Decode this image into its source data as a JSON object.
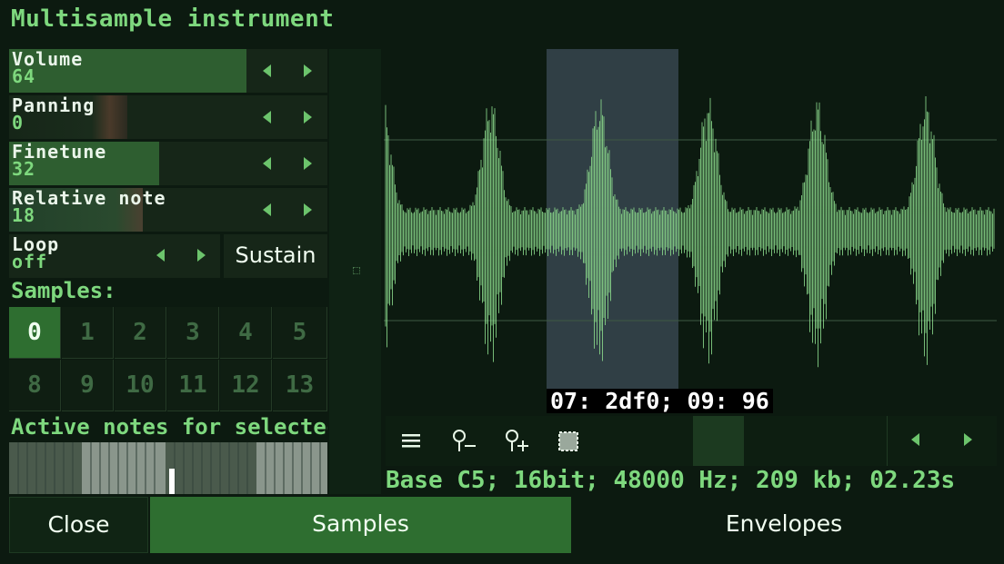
{
  "title": "Multisample instrument",
  "params": [
    {
      "name": "Volume",
      "value": "64",
      "fill": 0.745
    },
    {
      "name": "Panning",
      "value": "0",
      "fill": 0.37
    },
    {
      "name": "Finetune",
      "value": "32",
      "fill": 0.47
    },
    {
      "name": "Relative note",
      "value": "18",
      "fill": 0.42
    }
  ],
  "loop": {
    "name": "Loop",
    "value": "off"
  },
  "sustain_label": "Sustain",
  "samples_label": "Samples:",
  "samples": [
    "0",
    "1",
    "2",
    "3",
    "4",
    "5",
    "8",
    "9",
    "10",
    "11",
    "12",
    "13"
  ],
  "active_sample": "0",
  "active_notes_label": "Active notes for selected",
  "selection_readout": "07: 2df0; 09: 96",
  "info": "Base C5; 16bit; 48000 Hz; 209 kb; 02.23s",
  "buttons": {
    "close": "Close",
    "samples": "Samples",
    "envelopes": "Envelopes"
  },
  "icons": [
    "menu-icon",
    "zoom-out-icon",
    "zoom-in-icon",
    "select-all-icon"
  ],
  "colors": {
    "accent": "#2e6e30",
    "text": "#7ed87e",
    "wave": "#8fe08f"
  }
}
